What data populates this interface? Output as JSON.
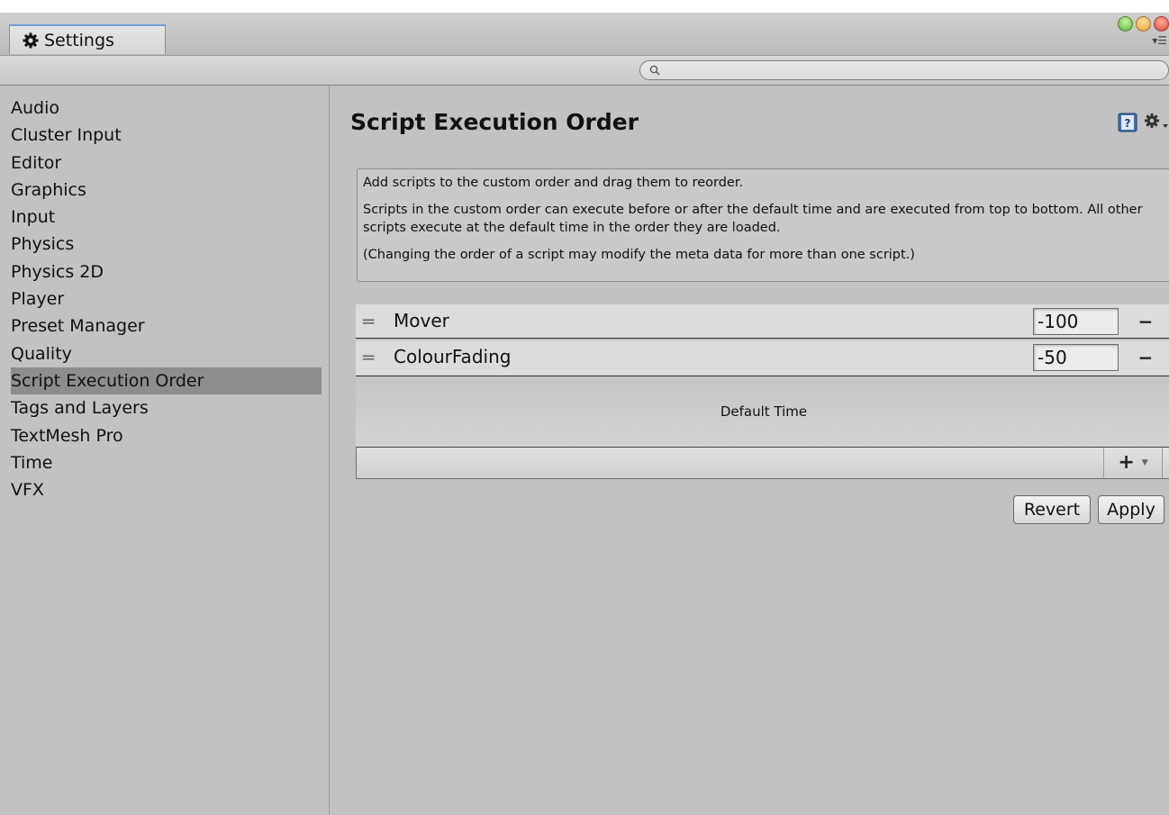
{
  "window": {
    "tab_title": "Settings"
  },
  "search": {
    "value": "",
    "placeholder": ""
  },
  "sidebar": {
    "items": [
      {
        "label": "Audio"
      },
      {
        "label": "Cluster Input"
      },
      {
        "label": "Editor"
      },
      {
        "label": "Graphics"
      },
      {
        "label": "Input"
      },
      {
        "label": "Physics"
      },
      {
        "label": "Physics 2D"
      },
      {
        "label": "Player"
      },
      {
        "label": "Preset Manager"
      },
      {
        "label": "Quality"
      },
      {
        "label": "Script Execution Order",
        "selected": true
      },
      {
        "label": "Tags and Layers"
      },
      {
        "label": "TextMesh Pro"
      },
      {
        "label": "Time"
      },
      {
        "label": "VFX"
      }
    ]
  },
  "main": {
    "title": "Script Execution Order",
    "info": {
      "line1": "Add scripts to the custom order and drag them to reorder.",
      "line2": "Scripts in the custom order can execute before or after the default time and are executed from top to bottom. All other scripts execute at the default time in the order they are loaded.",
      "line3": "(Changing the order of a script may modify the meta data for more than one script.)"
    },
    "scripts": [
      {
        "name": "Mover",
        "order": "-100"
      },
      {
        "name": "ColourFading",
        "order": "-50"
      }
    ],
    "default_time_label": "Default Time",
    "add_label": "+",
    "revert_label": "Revert",
    "apply_label": "Apply"
  },
  "colors": {
    "background": "#c2c2c2",
    "selected_item": "#8d8d8d",
    "tab_accent": "#6f9fd8"
  },
  "icons": {
    "tab": "gear-icon",
    "search": "magnifier-icon",
    "help": "help-book-icon",
    "settings": "gear-dropdown-icon",
    "drag": "drag-handle-icon",
    "remove": "minus-icon",
    "add": "plus-icon"
  }
}
